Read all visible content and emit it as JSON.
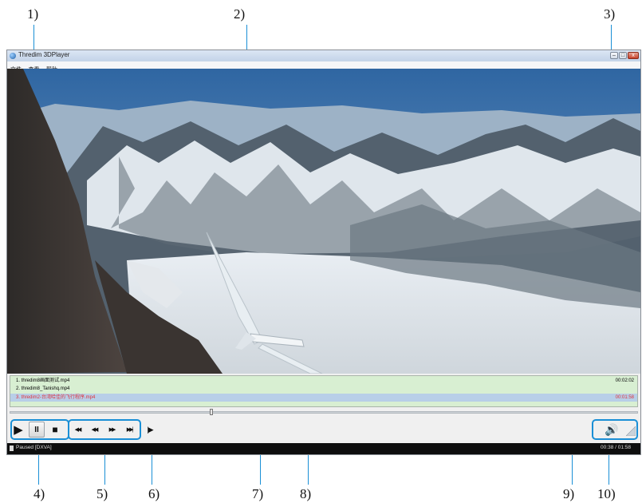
{
  "callouts": [
    "1)",
    "2)",
    "3)",
    "4)",
    "5)",
    "6)",
    "7)",
    "8)",
    "9)",
    "10)"
  ],
  "window": {
    "title": "Thredim 3DPlayer",
    "minimize": "–",
    "maximize": "□",
    "close": "x"
  },
  "menu": [
    "文件",
    "查看",
    "帮助"
  ],
  "playlist": [
    {
      "name": "1. thredim8画面测试.mp4",
      "duration": "00:02:02",
      "selected": false
    },
    {
      "name": "2. thredim8_Tanishq.mp4",
      "duration": "",
      "selected": false
    },
    {
      "name": "3. thredim2-台湾哈佳的飞行程序.mp4",
      "duration": "00:01:58",
      "selected": true
    }
  ],
  "seek": {
    "progress": 0.32
  },
  "controls": {
    "play": "▶",
    "pause": "II",
    "stop": "■",
    "skip_back": "◀◀",
    "rewind": "◀◀",
    "forward": "▶▶",
    "skip_forward": "▶▶|",
    "frame_step": "|▶",
    "volume": "🔊"
  },
  "status": {
    "state": "Paused [DXVA]",
    "time": "00:38 / 01:58"
  },
  "colors": {
    "accent": "#1a8fd6",
    "playlist_bg": "#d8efd2",
    "selected_text": "#e0323a"
  }
}
